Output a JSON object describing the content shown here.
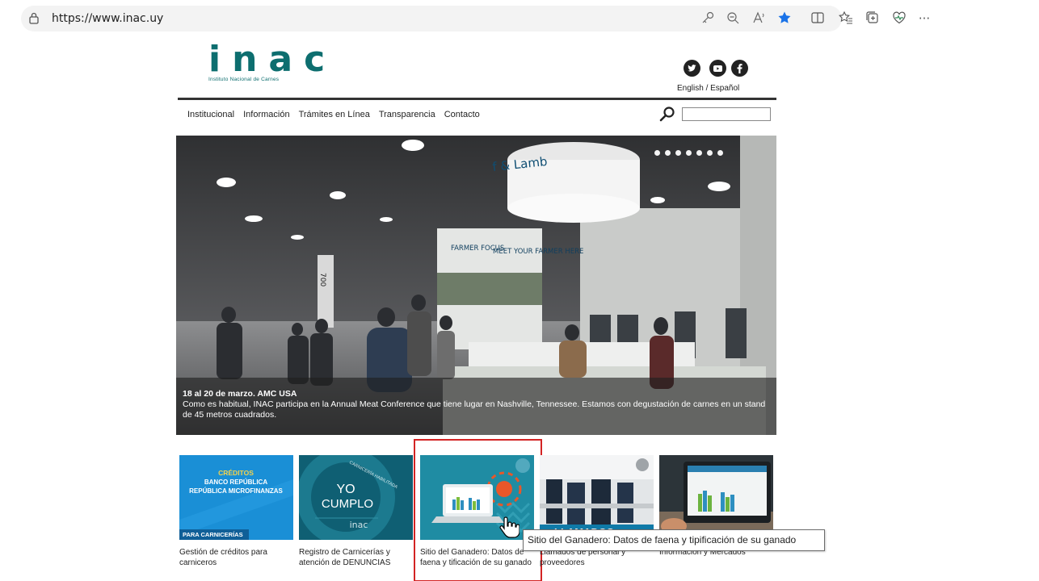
{
  "browser": {
    "url": "https://www.inac.uy",
    "more_label": "···"
  },
  "site": {
    "logo_text": "inac",
    "logo_subtitle": "Instituto Nacional de Carnes",
    "language_label": "English / Español",
    "nav": [
      "Institucional",
      "Información",
      "Trámites en Línea",
      "Transparencia",
      "Contacto"
    ],
    "search_placeholder": ""
  },
  "hero": {
    "slide_count": 7,
    "caption_title": "18 al 20 de marzo. AMC USA",
    "caption_text": "Como es habitual, INAC participa en la Annual Meat Conference que tiene lugar en Nashville, Tennessee. Estamos con degustación de carnes en un stand de 45 metros cuadrados.",
    "banner_text": "f & Lamb",
    "booth_left": "FARMER FOCUS",
    "booth_right": "MEET YOUR FARMER HERE",
    "pillar_text": "700"
  },
  "tiles": [
    {
      "title_lines": [
        "CRÉDITOS",
        "BANCO REPÚBLICA",
        "REPÚBLICA MICROFINANZAS"
      ],
      "tag": "PARA CARNICERÍAS",
      "label": "Gestión de créditos para carniceros"
    },
    {
      "title_lines": [
        "YO",
        "CUMPLO"
      ],
      "tag": "inac",
      "ring_text": "CARNICERÍA HABILITADA",
      "label": "Registro de Carnicerías y atención de DENUNCIAS"
    },
    {
      "label": "Sitio del Ganadero: Datos de faena y tificación de su ganado"
    },
    {
      "overlay": "LLAMADOS",
      "label": "Llamados de personal y proveedores"
    },
    {
      "label": "Información y Mercados"
    }
  ],
  "tooltip": "Sitio del Ganadero: Datos de faena y tipificación de su ganado",
  "colors": {
    "brand": "#0d6e6f",
    "tile_blue": "#1a8fd6",
    "tile_teal": "#0f5f73",
    "highlight": "#d32424"
  }
}
